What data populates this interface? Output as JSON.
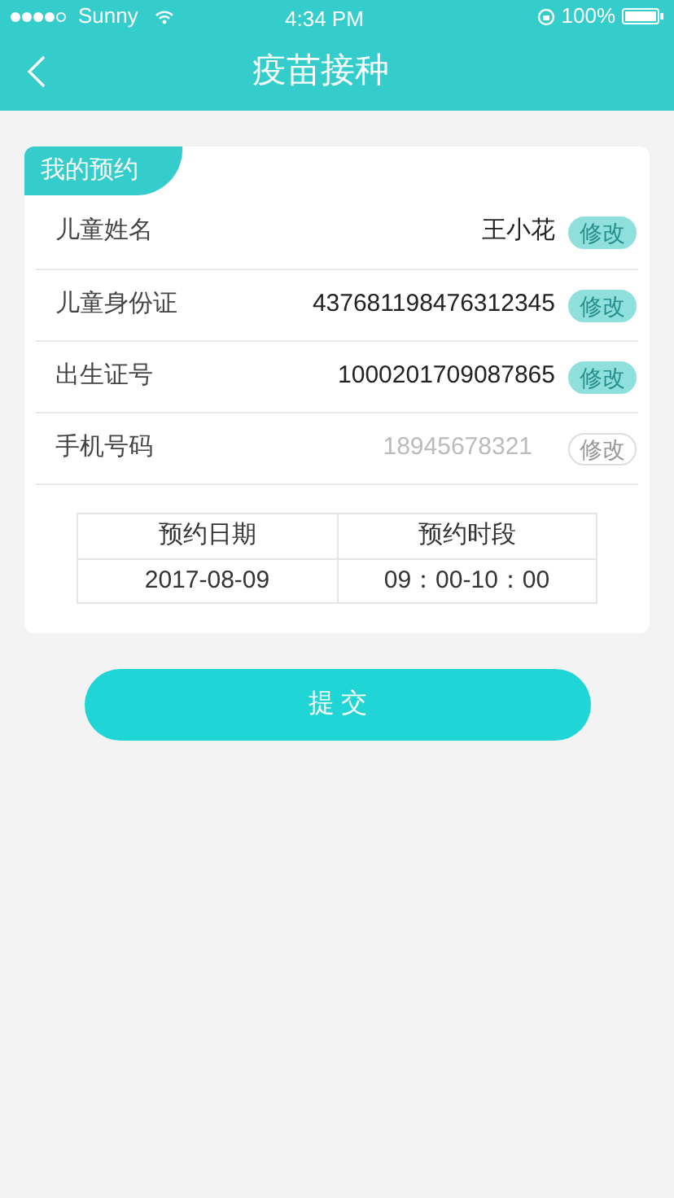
{
  "status_bar": {
    "carrier": "Sunny",
    "time": "4:34 PM",
    "battery": "100%"
  },
  "nav": {
    "title": "疫苗接种"
  },
  "card": {
    "tab": "我的预约",
    "fields": [
      {
        "label": "儿童姓名",
        "value": "王小花",
        "action": "修改",
        "disabled": false
      },
      {
        "label": "儿童身份证",
        "value": "437681198476312345",
        "action": "修改",
        "disabled": false
      },
      {
        "label": "出生证号",
        "value": "1000201709087865",
        "action": "修改",
        "disabled": false
      },
      {
        "label": "手机号码",
        "value": "18945678321",
        "action": "修改",
        "disabled": true
      }
    ],
    "table": {
      "columns": [
        "预约日期",
        "预约时段"
      ],
      "rows": [
        [
          "2017-08-09",
          "09：00-10：00"
        ]
      ]
    }
  },
  "submit_button": "提 交"
}
